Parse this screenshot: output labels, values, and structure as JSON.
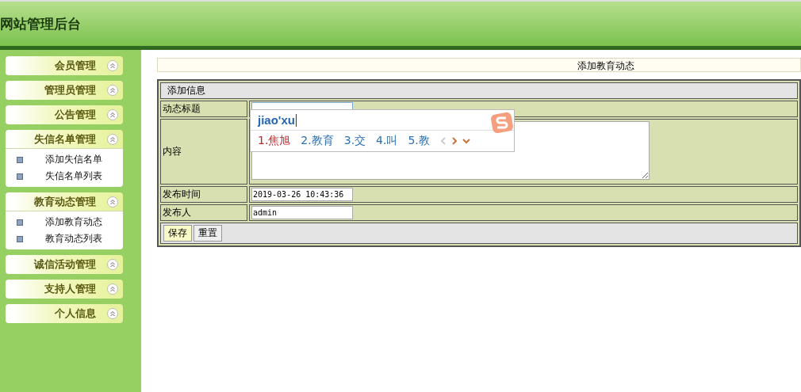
{
  "header": {
    "title": "网站管理后台"
  },
  "sidebar": {
    "groups": [
      {
        "label": "会员管理",
        "expanded": false
      },
      {
        "label": "管理员管理",
        "expanded": false
      },
      {
        "label": "公告管理",
        "expanded": false
      },
      {
        "label": "失信名单管理",
        "expanded": true,
        "items": [
          "添加失信名单",
          "失信名单列表"
        ]
      },
      {
        "label": "教育动态管理",
        "expanded": true,
        "items": [
          "添加教育动态",
          "教育动态列表"
        ]
      },
      {
        "label": "诚信活动管理",
        "expanded": false
      },
      {
        "label": "支持人管理",
        "expanded": false
      },
      {
        "label": "个人信息",
        "expanded": false
      }
    ]
  },
  "page_title": "添加教育动态",
  "form": {
    "section": "添加信息",
    "fields": [
      {
        "kind": "input",
        "label": "动态标题"
      },
      {
        "kind": "textarea",
        "label": "内容"
      },
      {
        "kind": "input",
        "label": "发布时间",
        "value": "2019-03-26 10:43:36"
      },
      {
        "kind": "input",
        "label": "发布人",
        "value": "admin"
      }
    ],
    "buttons": [
      {
        "label": "保存",
        "selected": true
      },
      {
        "label": "重置",
        "selected": false
      }
    ]
  },
  "ime": {
    "composition": "jiao'xu",
    "candidates": [
      {
        "label": "1.焦旭",
        "selected": true
      },
      {
        "label": "2.教育",
        "selected": false
      },
      {
        "label": "3.交",
        "selected": false
      },
      {
        "label": "4.叫",
        "selected": false
      },
      {
        "label": "5.教",
        "selected": false
      }
    ]
  }
}
